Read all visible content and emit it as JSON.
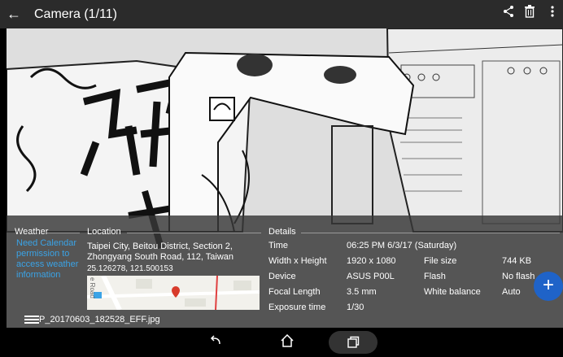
{
  "topbar": {
    "title": "Camera (1/11)",
    "back_icon": "arrow-left-icon",
    "share_icon": "share-icon",
    "delete_icon": "trash-icon",
    "more_icon": "more-vertical-icon"
  },
  "weather": {
    "header": "Weather",
    "message": "Need Calendar permission to access weather information"
  },
  "location": {
    "header": "Location",
    "address": "Taipei City, Beitou District, Section 2, Zhongyang South Road, 112, Taiwan",
    "coordinates": "25.126278, 121.500153",
    "map_label": "e Road"
  },
  "details": {
    "header": "Details",
    "rows": [
      {
        "label": "Time",
        "value": "06:25 PM 6/3/17 (Saturday)"
      },
      {
        "label": "Width x Height",
        "value": "1920 x 1080",
        "label2": "File size",
        "value2": "744 KB"
      },
      {
        "label": "Device",
        "value": "ASUS P00L",
        "label2": "Flash",
        "value2": "No flash"
      },
      {
        "label": "Focal Length",
        "value": "3.5 mm",
        "label2": "White balance",
        "value2": "Auto"
      },
      {
        "label": "Exposure time",
        "value": "1/30"
      }
    ]
  },
  "file": {
    "name": "P_20170603_182528_EFF.jpg"
  },
  "colors": {
    "link": "#3aa3e6",
    "fab": "#1f63c8",
    "map_pin": "#d83b2b"
  },
  "nav": {
    "back_icon": "nav-back-icon",
    "home_icon": "nav-home-icon",
    "recents_icon": "nav-recents-icon"
  }
}
